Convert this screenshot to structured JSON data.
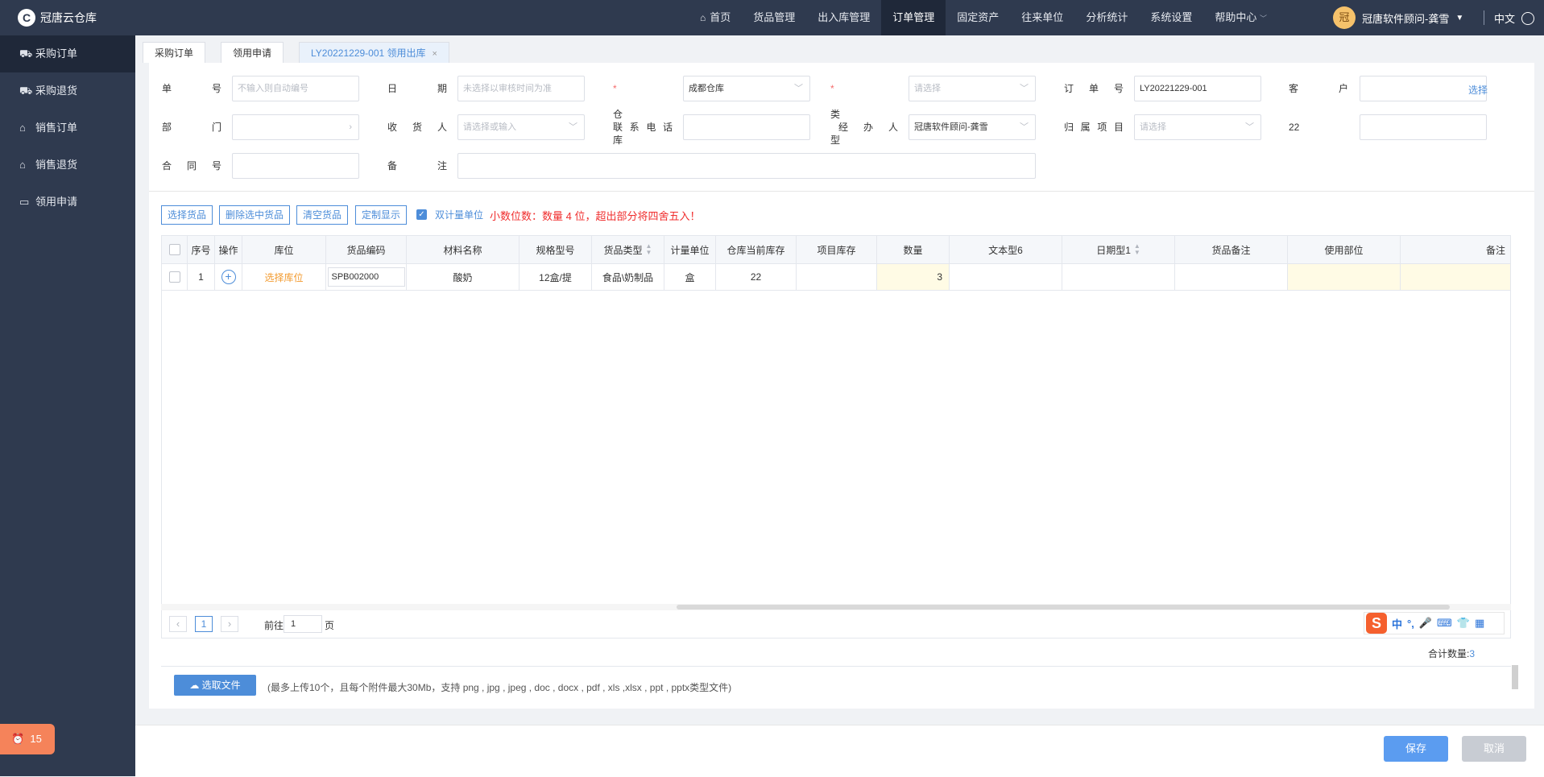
{
  "app": {
    "logo_mark": "C",
    "title": "冠唐云仓库"
  },
  "nav": {
    "home": "首页",
    "items": [
      "货品管理",
      "出入库管理",
      "订单管理",
      "固定资产",
      "往来单位",
      "分析统计",
      "系统设置",
      "帮助中心"
    ],
    "help_caret": "﹀"
  },
  "user": {
    "avatar": "冠",
    "name": "冠唐软件顾问-龚雪",
    "lang": "中文"
  },
  "sidebar": {
    "items": [
      {
        "label": "采购订单",
        "icon": "cart-icon"
      },
      {
        "label": "采购退货",
        "icon": "cart-icon"
      },
      {
        "label": "销售订单",
        "icon": "bag-icon"
      },
      {
        "label": "销售退货",
        "icon": "bag-icon"
      },
      {
        "label": "领用申请",
        "icon": "briefcase-icon"
      }
    ],
    "badge_count": "15"
  },
  "tabs": [
    {
      "label": "采购订单"
    },
    {
      "label": "领用申请"
    },
    {
      "label": "LY20221229-001 领用出库",
      "close": "×"
    }
  ],
  "form": {
    "labels": {
      "danhao": "单号",
      "riqi": "日期",
      "cangku": "仓库",
      "leixing": "类型",
      "dingdanhao": "订单号",
      "kehu": "客户",
      "bumen": "部门",
      "shouhuoren": "收货人",
      "lianxidianhua": "联系电话",
      "jingbanren": "经办人",
      "guishuxiangmu": "归属项目",
      "f22": "22",
      "hetonghao": "合同号",
      "beizhu": "备注"
    },
    "values": {
      "danhao_ph": "不输入则自动编号",
      "riqi_ph": "未选择以审核时间为准",
      "cangku": "成都仓库",
      "leixing_ph": "请选择",
      "dingdanhao": "LY20221229-001",
      "kehu": "",
      "bumen": "",
      "shouhuoren_ph": "请选择或输入",
      "lianxidianhua": "",
      "jingbanren": "冠唐软件顾问-龚雪",
      "guishuxiangmu_ph": "请选择",
      "f22": "",
      "hetonghao": "",
      "beizhu": ""
    },
    "select_link": "选择"
  },
  "toolbar": {
    "select_goods": "选择货品",
    "delete_selected": "删除选中货品",
    "clear_goods": "清空货品",
    "custom_display": "定制显示",
    "dual_unit_label": "双计量单位",
    "decimal_warning": "小数位数：数量 4 位，超出部分将四舍五入！"
  },
  "table": {
    "headers": [
      "",
      "序号",
      "操作",
      "库位",
      "货品编码",
      "材料名称",
      "规格型号",
      "货品类型",
      "计量单位",
      "仓库当前库存",
      "项目库存",
      "数量",
      "文本型6",
      "日期型1",
      "货品备注",
      "使用部位",
      "备注"
    ],
    "rows": [
      {
        "seq": "1",
        "location": "选择库位",
        "code": "SPB002000",
        "name": "酸奶",
        "spec": "12盒/提",
        "type": "食品\\奶制品",
        "unit": "盒",
        "stock": "22",
        "project_stock": "",
        "qty": "3",
        "text6": "",
        "date1": "",
        "goods_note": "",
        "use_part": "",
        "note": ""
      }
    ]
  },
  "pager": {
    "prev": "‹",
    "current": "1",
    "next": "›",
    "goto_prefix": "前往",
    "goto_value": "1",
    "goto_suffix": "页"
  },
  "ime": {
    "logo": "S",
    "icons": [
      "中",
      "°,",
      "🎤",
      "⌨",
      "👕",
      "▦"
    ]
  },
  "summary": {
    "total_label": "合计数量:",
    "total_value": "3"
  },
  "upload": {
    "button": "选取文件",
    "note": "(最多上传10个，且每个附件最大30Mb，支持 png , jpg , jpeg , doc , docx , pdf , xls ,xlsx , ppt , pptx类型文件)"
  },
  "actions": {
    "save": "保存",
    "cancel": "取消"
  },
  "colors": {
    "accent": "#4d8dd9",
    "sidebar": "#2f3a4f",
    "warning": "#f02d2d",
    "badge": "#f5835a"
  }
}
